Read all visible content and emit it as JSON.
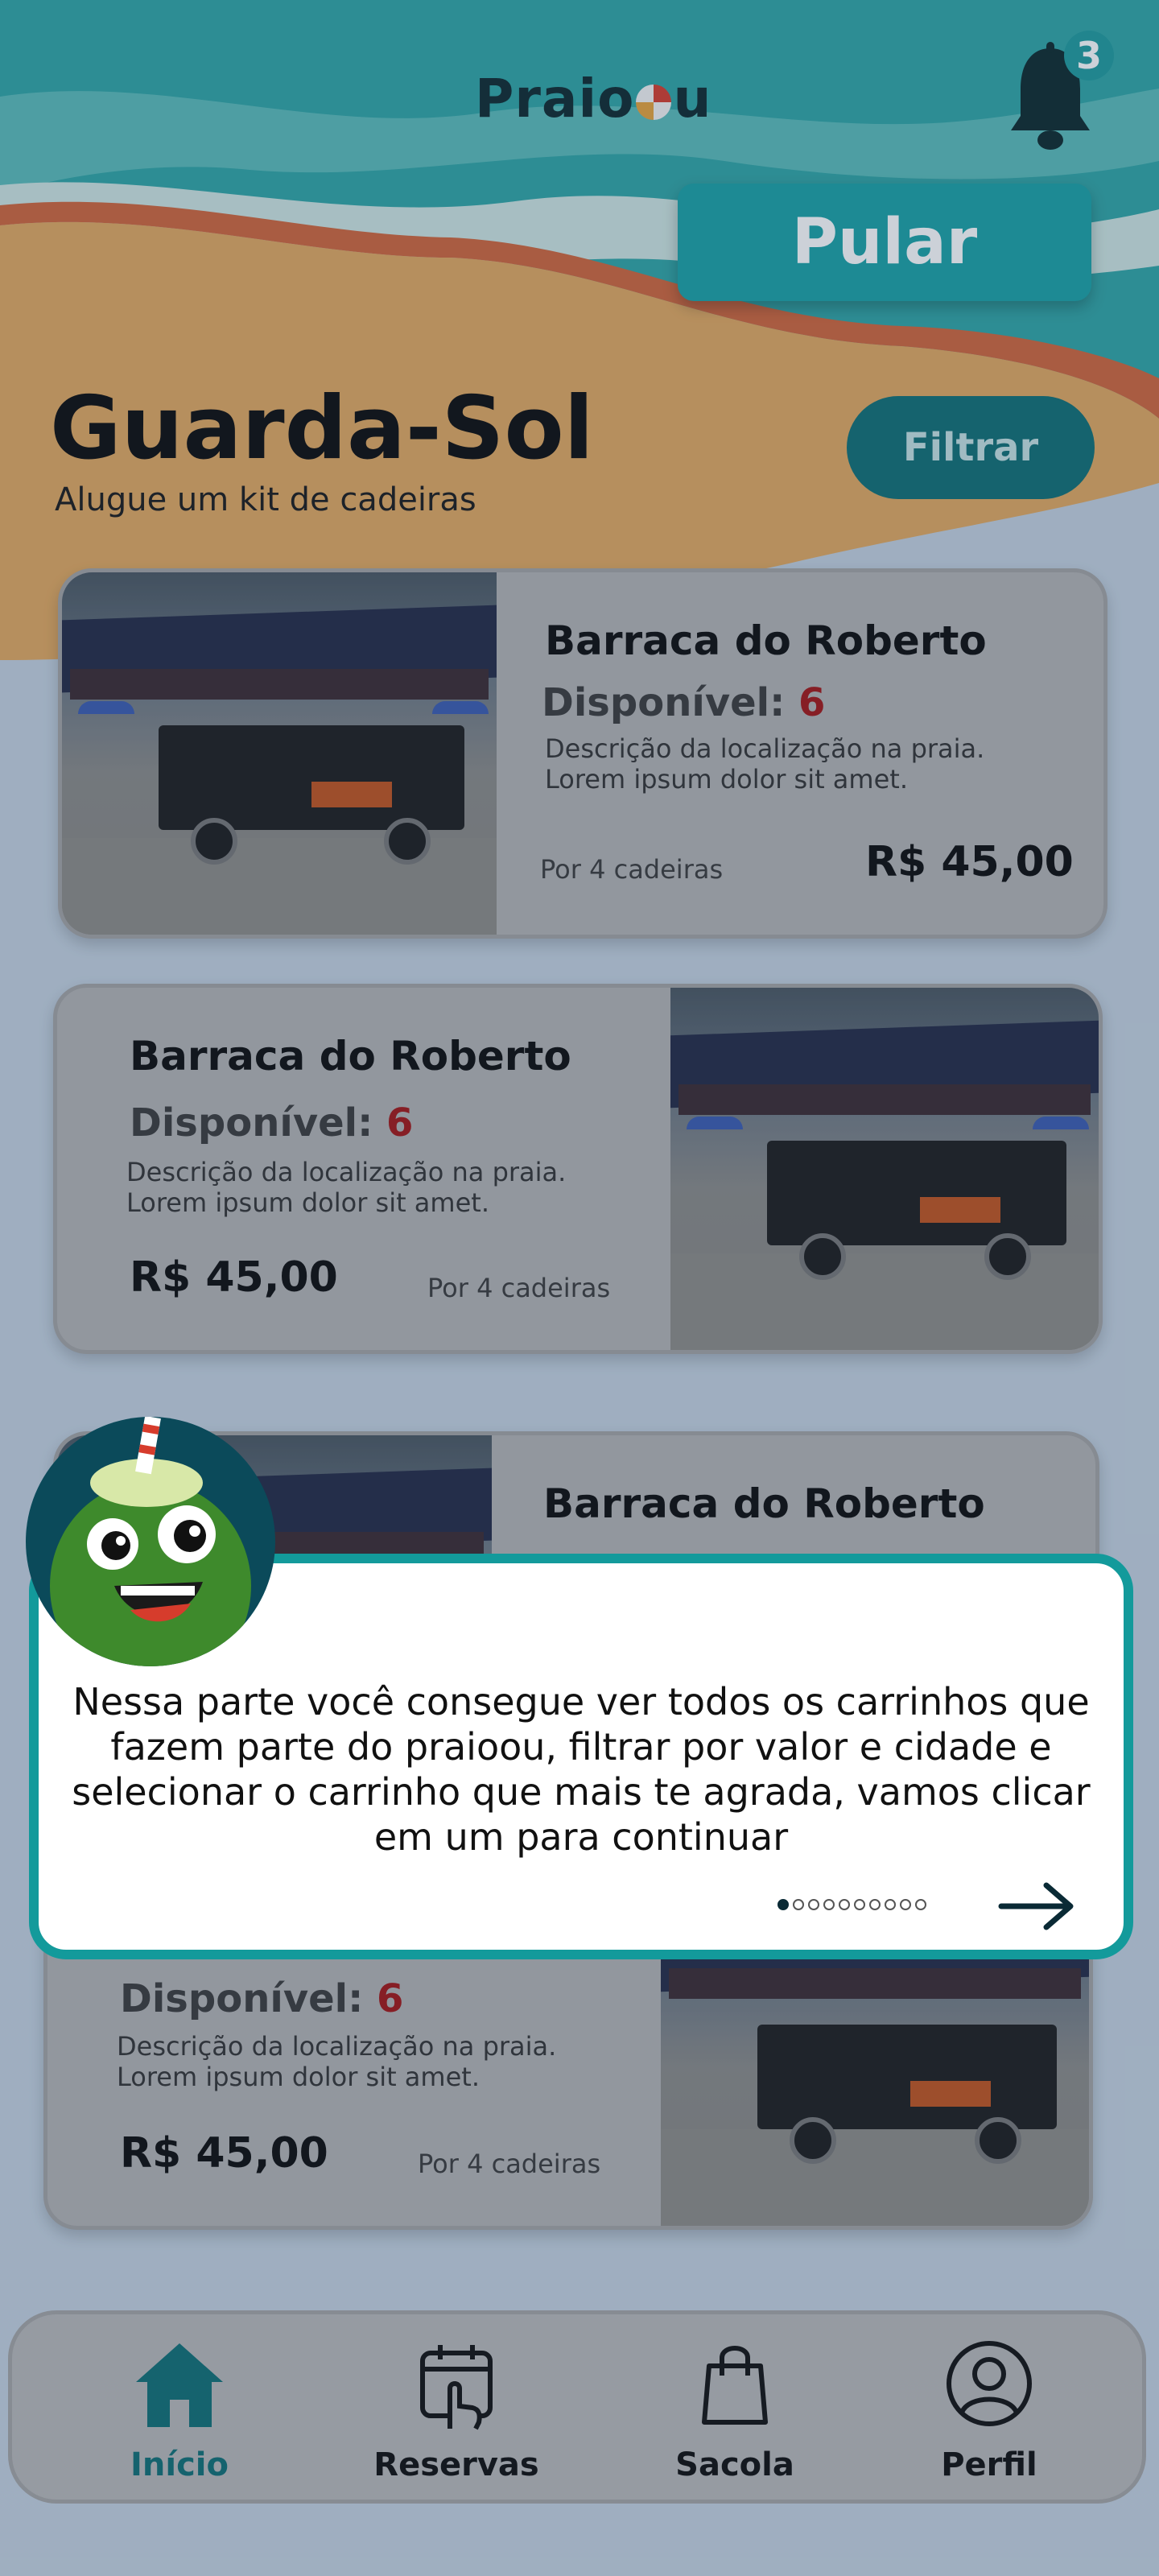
{
  "colors": {
    "teal": "#19a2a6",
    "dark_teal": "#0f6f74",
    "sand": "#e3a95f",
    "sky_gray": "#c6d3e1",
    "card_gray": "#b3b3b3",
    "available_red": "#a31414"
  },
  "header": {
    "logo_text_start": "Praio",
    "logo_text_end": "u",
    "logo_icon": "beach-ball-icon",
    "notification_icon": "bell-icon",
    "notification_count": "3"
  },
  "skip_button": {
    "label": "Pular"
  },
  "page": {
    "title": "Guarda-Sol",
    "subtitle": "Alugue um kit de cadeiras",
    "filter_label": "Filtrar"
  },
  "cards": [
    {
      "name": "Barraca do Roberto",
      "available_label": "Disponível:",
      "available_count": "6",
      "description_line1": "Descrição da localização na praia.",
      "description_line2": "Lorem ipsum dolor sit amet.",
      "price": "R$ 45,00",
      "per": "Por 4 cadeiras"
    },
    {
      "name": "Barraca do Roberto",
      "available_label": "Disponível:",
      "available_count": "6",
      "description_line1": "Descrição da localização na praia.",
      "description_line2": "Lorem ipsum dolor sit amet.",
      "price": "R$ 45,00",
      "per": "Por 4 cadeiras"
    },
    {
      "name": "Barraca do Roberto"
    },
    {
      "available_label": "Disponível:",
      "available_count": "6",
      "description_line1": "Descrição da localização na praia.",
      "description_line2": "Lorem ipsum dolor sit amet.",
      "price": "R$ 45,00",
      "per": "Por 4 cadeiras"
    }
  ],
  "tutorial": {
    "text": "Nessa parte você consegue ver todos os carrinhos que fazem parte do praioou, filtrar por valor e cidade e selecionar o carrinho que mais te agrada, vamos clicar em um para continuar",
    "mascot_icon": "coconut-mascot-icon",
    "next_icon": "arrow-right-icon",
    "step_current": 1,
    "step_total": 10
  },
  "nav": {
    "items": [
      {
        "label": "Início",
        "icon": "home-icon",
        "active": true
      },
      {
        "label": "Reservas",
        "icon": "calendar-touch-icon",
        "active": false
      },
      {
        "label": "Sacola",
        "icon": "shopping-bag-icon",
        "active": false
      },
      {
        "label": "Perfil",
        "icon": "user-icon",
        "active": false
      }
    ]
  }
}
